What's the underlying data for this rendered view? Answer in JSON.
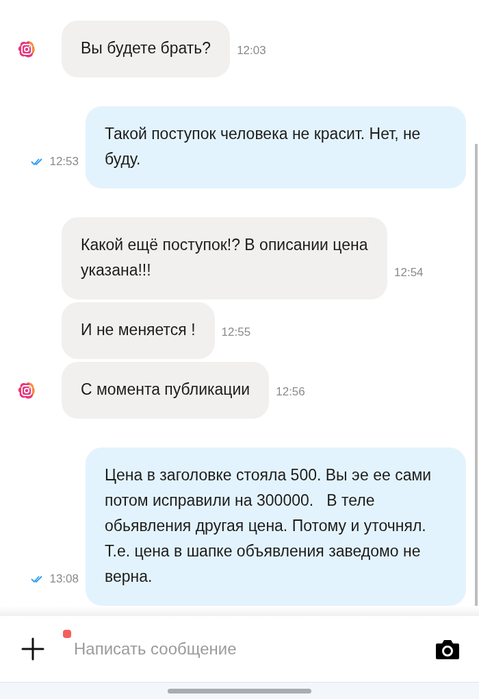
{
  "messages": [
    {
      "kind": "incoming",
      "show_avatar": true,
      "text": "Вы будете брать?",
      "time": "12:03"
    },
    {
      "kind": "outgoing",
      "read": true,
      "text": "Такой поступок человека не красит. Нет, не буду.",
      "time": "12:53"
    },
    {
      "kind": "incoming",
      "show_avatar": false,
      "text": "Какой ещё поступок!? В описании цена указана!!!",
      "time": "12:54"
    },
    {
      "kind": "incoming",
      "show_avatar": false,
      "text": "И не меняется !",
      "time": "12:55"
    },
    {
      "kind": "incoming",
      "show_avatar": true,
      "text": "С момента публикации",
      "time": "12:56"
    },
    {
      "kind": "outgoing",
      "read": true,
      "text": "Цена в заголовке стояла 500. Вы эе ее сами потом исправили на 300000.   В теле обьявления другая цена. Потому и уточнял.  Т.е. цена в шапке объявления заведомо не верна.",
      "time": "13:08"
    }
  ],
  "composer": {
    "placeholder": "Написать сообщение",
    "attachment_badge": true
  }
}
